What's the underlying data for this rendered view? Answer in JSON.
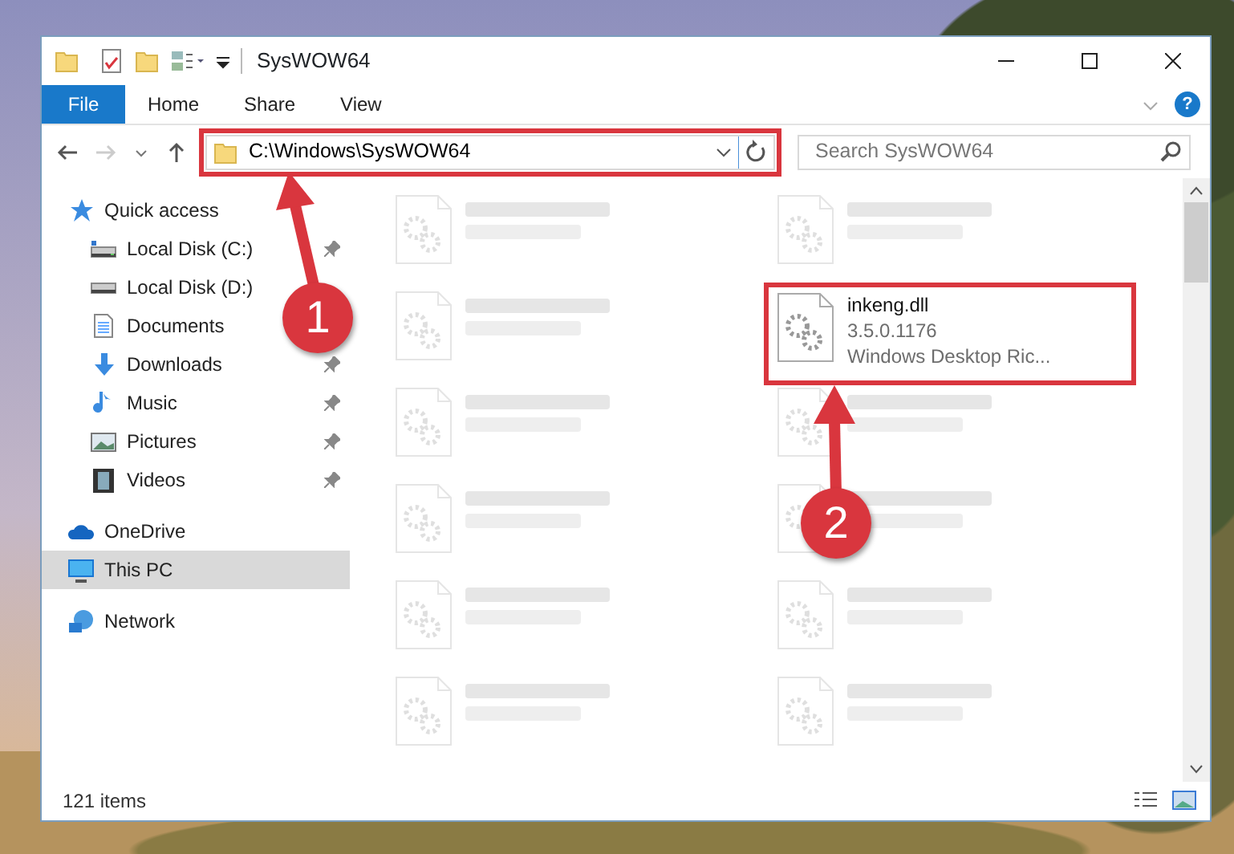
{
  "window": {
    "title": "SysWOW64",
    "help": "?"
  },
  "ribbon_tabs": [
    {
      "label": "File",
      "kind": "file",
      "selected": false
    },
    {
      "label": "Home",
      "kind": "tab",
      "selected": false
    },
    {
      "label": "Share",
      "kind": "tab",
      "selected": false
    },
    {
      "label": "View",
      "kind": "tab",
      "selected": false
    }
  ],
  "address": {
    "path": "C:\\Windows\\SysWOW64",
    "highlighted": true
  },
  "search": {
    "placeholder": "Search SysWOW64"
  },
  "sidebar": {
    "items": [
      {
        "label": "Quick access",
        "kind": "star",
        "pinned": false,
        "selected": false
      },
      {
        "label": "Local Disk (C:)",
        "kind": "diskc",
        "pinned": true,
        "selected": false
      },
      {
        "label": "Local Disk (D:)",
        "kind": "disk",
        "pinned": false,
        "selected": false
      },
      {
        "label": "Documents",
        "kind": "docs",
        "pinned": false,
        "selected": false
      },
      {
        "label": "Downloads",
        "kind": "down",
        "pinned": true,
        "selected": false
      },
      {
        "label": "Music",
        "kind": "music",
        "pinned": true,
        "selected": false
      },
      {
        "label": "Pictures",
        "kind": "pics",
        "pinned": true,
        "selected": false
      },
      {
        "label": "Videos",
        "kind": "video",
        "pinned": true,
        "selected": false
      },
      {
        "label": "OneDrive",
        "kind": "cloud",
        "pinned": false,
        "selected": false
      },
      {
        "label": "This PC",
        "kind": "pc",
        "pinned": false,
        "selected": true
      },
      {
        "label": "Network",
        "kind": "net",
        "pinned": false,
        "selected": false
      }
    ]
  },
  "files": [
    {
      "kind": "blurred"
    },
    {
      "kind": "blurred"
    },
    {
      "kind": "blurred"
    },
    {
      "kind": "file",
      "name": "inkeng.dll",
      "lines": [
        "3.5.0.1176",
        "Windows Desktop Ric..."
      ],
      "highlighted": true
    },
    {
      "kind": "blurred"
    },
    {
      "kind": "blurred"
    },
    {
      "kind": "blurred"
    },
    {
      "kind": "blurred"
    },
    {
      "kind": "blurred"
    },
    {
      "kind": "blurred"
    },
    {
      "kind": "blurred"
    },
    {
      "kind": "blurred"
    }
  ],
  "status_bar": {
    "count": "121 items"
  },
  "annotations": [
    {
      "label": "1"
    },
    {
      "label": "2"
    }
  ]
}
